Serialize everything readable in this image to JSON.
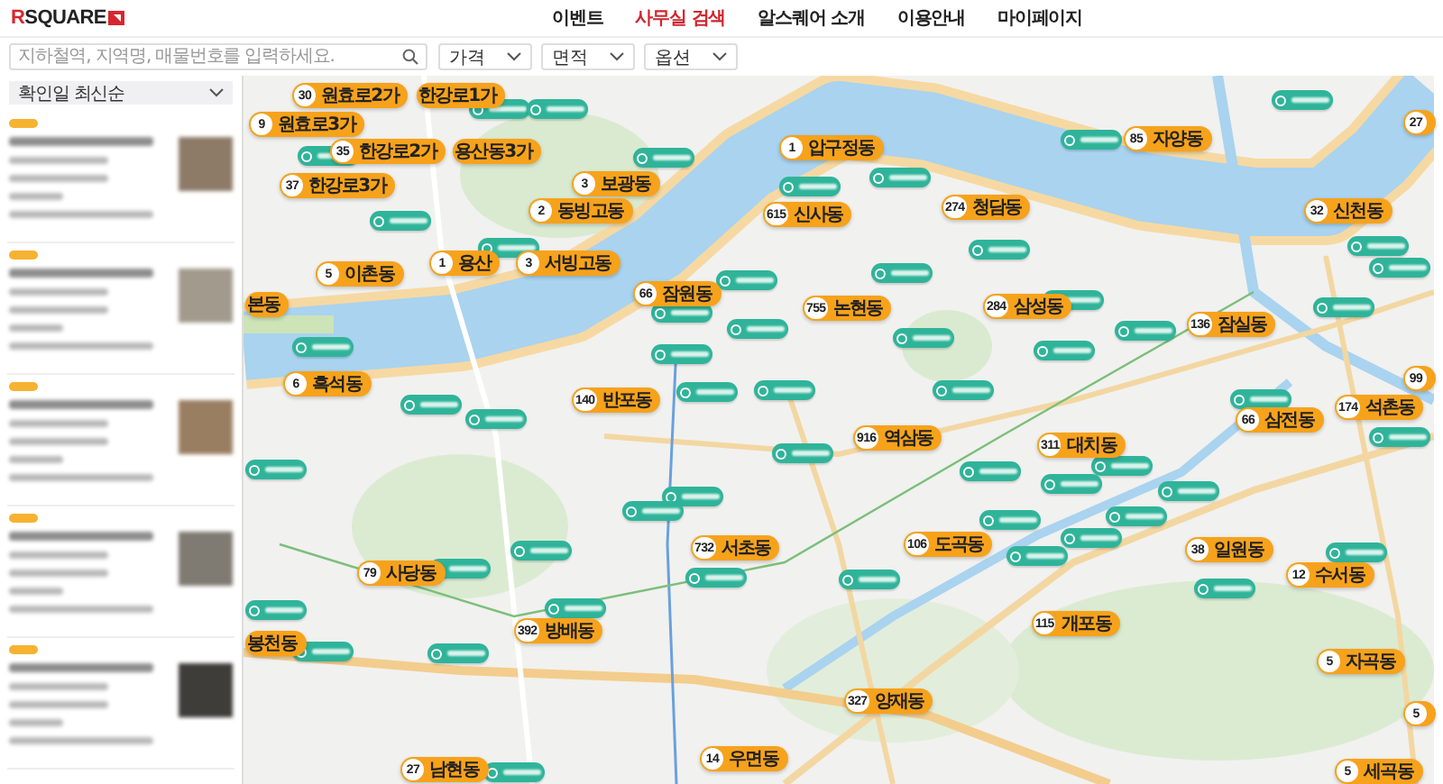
{
  "header": {
    "logo": "RSQUARE",
    "nav": [
      {
        "label": "이벤트",
        "selected": false
      },
      {
        "label": "사무실 검색",
        "selected": true
      },
      {
        "label": "알스퀘어 소개",
        "selected": false
      },
      {
        "label": "이용안내",
        "selected": false
      },
      {
        "label": "마이페이지",
        "selected": false
      }
    ]
  },
  "filters": {
    "search": {
      "placeholder": "지하철역, 지역명, 매물번호를 입력하세요."
    },
    "dropdowns": [
      "가격",
      "면적",
      "옵션"
    ]
  },
  "sidebar": {
    "sort": "확인일 최신순",
    "listings": [
      {
        "badge": true
      },
      {
        "badge": true
      },
      {
        "badge": true
      },
      {
        "badge": true
      },
      {
        "badge": true
      }
    ]
  },
  "map": {
    "district_markers": [
      {
        "count": "30",
        "name": "원효로2가"
      },
      {
        "name": "한강로1가"
      },
      {
        "count": "9",
        "name": "원효로3가"
      },
      {
        "count": "27"
      },
      {
        "count": "35",
        "name": "한강로2가"
      },
      {
        "name": "용산동3가"
      },
      {
        "count": "1",
        "name": "압구정동"
      },
      {
        "count": "85",
        "name": "자양동"
      },
      {
        "count": "37",
        "name": "한강로3가"
      },
      {
        "count": "3",
        "name": "보광동"
      },
      {
        "count": "2",
        "name": "동빙고동"
      },
      {
        "count": "615",
        "name": "신사동"
      },
      {
        "count": "274",
        "name": "청담동"
      },
      {
        "count": "32",
        "name": "신천동"
      },
      {
        "count": "5",
        "name": "이촌동"
      },
      {
        "count": "1",
        "name": "용산"
      },
      {
        "count": "3",
        "name": "서빙고동"
      },
      {
        "name": "본동"
      },
      {
        "count": "66",
        "name": "잠원동"
      },
      {
        "count": "755",
        "name": "논현동"
      },
      {
        "count": "284",
        "name": "삼성동"
      },
      {
        "count": "136",
        "name": "잠실동"
      },
      {
        "count": "6",
        "name": "흑석동"
      },
      {
        "count": "140",
        "name": "반포동"
      },
      {
        "count": "66",
        "name": "삼전동"
      },
      {
        "count": "174",
        "name": "석촌동"
      },
      {
        "count": "99"
      },
      {
        "count": "916",
        "name": "역삼동"
      },
      {
        "count": "311",
        "name": "대치동"
      },
      {
        "count": "79",
        "name": "사당동"
      },
      {
        "count": "732",
        "name": "서초동"
      },
      {
        "count": "106",
        "name": "도곡동"
      },
      {
        "count": "38",
        "name": "일원동"
      },
      {
        "count": "12",
        "name": "수서동"
      },
      {
        "name": "봉천동"
      },
      {
        "count": "392",
        "name": "방배동"
      },
      {
        "count": "115",
        "name": "개포동"
      },
      {
        "count": "5",
        "name": "자곡동"
      },
      {
        "count": "327",
        "name": "양재동"
      },
      {
        "count": "5"
      },
      {
        "count": "27",
        "name": "남현동"
      },
      {
        "count": "14",
        "name": "우면동"
      },
      {
        "count": "5",
        "name": "세곡동"
      }
    ]
  }
}
